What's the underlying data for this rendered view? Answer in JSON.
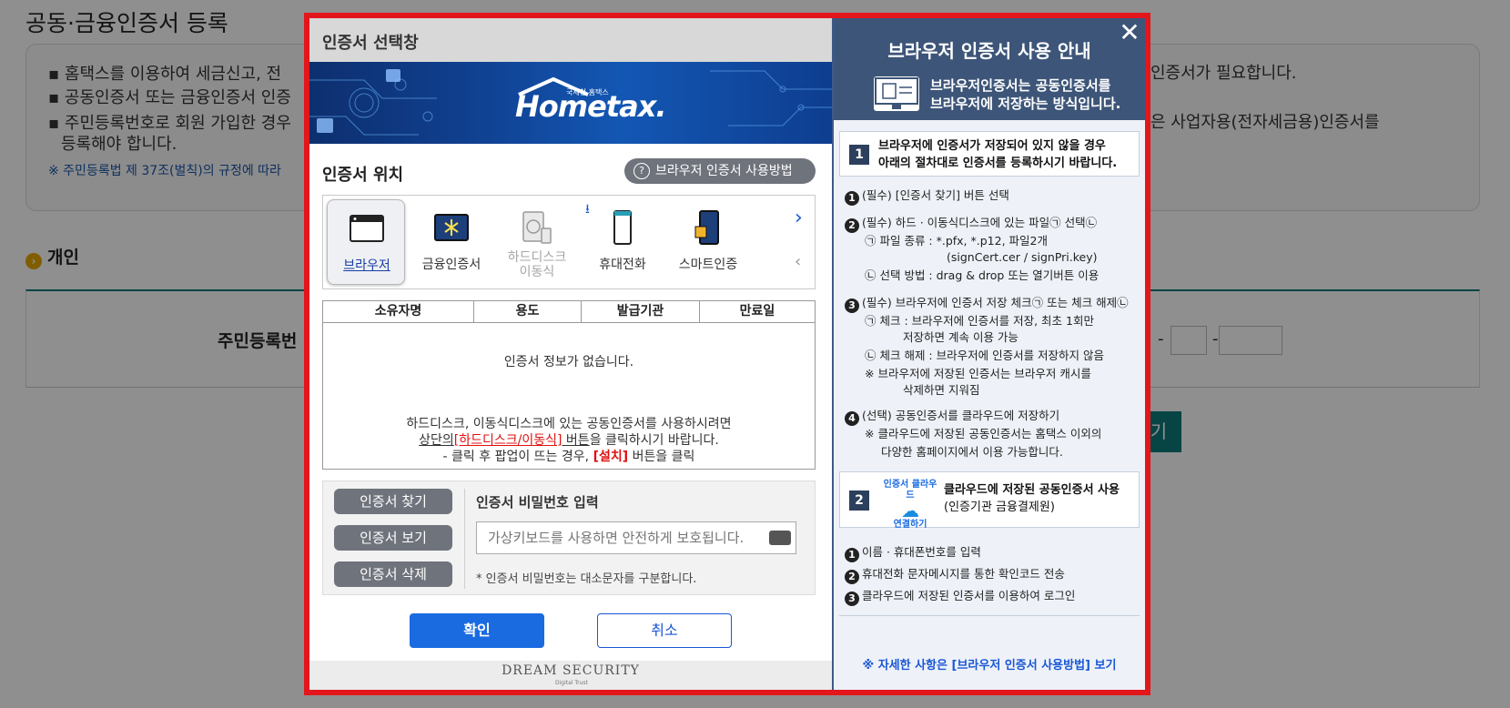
{
  "background": {
    "title": "공동·금융인증서 등록",
    "notice_lines": [
      "▪ 홈택스를 이용하여 세금신고, 전",
      "▪ 공동인증서 또는 금융인증서 인증",
      "▪ 주민등록번호로 회원 가입한 경우",
      "등록해야 합니다."
    ],
    "notice_law": "※ 주민등록법 제 37조(벌칙)의 규정에 따라",
    "notice_right_1": "인증서가 필요합니다.",
    "notice_right_2": "은 사업자용(전자세금용)인증서를",
    "section": "개인",
    "rrn_label": "주민등록번",
    "teal_btn": "기"
  },
  "modal": {
    "title": "인증서 선택창",
    "banner": {
      "brand": "Hometax.",
      "sub": "국세청 홈택스"
    },
    "location_title": "인증서 위치",
    "howto_button": "브라우저 인증서 사용방법",
    "locations": [
      {
        "label": "브라우저",
        "icon": "browser-icon",
        "active": true
      },
      {
        "label": "금융인증서",
        "icon": "financial-cert-icon",
        "active": false
      },
      {
        "label": "하드디스크\n이동식",
        "icon": "harddisk-icon",
        "active": false,
        "disabled": true
      },
      {
        "label": "휴대전화",
        "icon": "mobile-phone-icon",
        "active": false
      },
      {
        "label": "스마트인증",
        "icon": "smart-cert-icon",
        "active": false
      }
    ],
    "table": {
      "headers": [
        "소유자명",
        "용도",
        "발급기관",
        "만료일"
      ],
      "empty": "인증서 정보가 없습니다.",
      "msg_line1": "하드디스크, 이동식디스크에 있는 공동인증서를 사용하시려면",
      "msg_line2_a": "상단의",
      "msg_line2_b": "[하드디스크/이동식]",
      "msg_line2_c": " 버튼",
      "msg_line2_d": "을 클릭하시기 바랍니다.",
      "msg_line3_a": "- 클릭 후 팝업이 뜨는 경우, ",
      "msg_line3_b": "[설치]",
      "msg_line3_c": " 버튼을 클릭"
    },
    "buttons": {
      "find": "인증서 찾기",
      "view": "인증서 보기",
      "delete": "인증서 삭제"
    },
    "password": {
      "title": "인증서 비밀번호 입력",
      "placeholder": "가상키보드를 사용하면 안전하게 보호됩니다.",
      "note": "* 인증서 비밀번호는 대소문자를 구분합니다."
    },
    "ok": "확인",
    "cancel": "취소",
    "footer": {
      "brand": "DREAM SECURITY",
      "tagline": "Digital Trust"
    }
  },
  "guide": {
    "title": "브라우저 인증서 사용 안내",
    "desc1": "브라우저인증서는 공동인증서를",
    "desc2": "브라우저에 저장하는 방식입니다.",
    "close": "✕",
    "step1": {
      "num": "1",
      "line1": "브라우저에 인증서가 저장되어 있지 않을 경우",
      "line2": "아래의 절차대로 인증서를 등록하시기 바랍니다."
    },
    "s1_items": [
      "(필수) [인증서 찾기] 버튼 선택",
      "(필수) 하드 · 이동식디스크에 있는 파일㉠ 선택㉡",
      "㉠ 파일 종류 : *.pfx, *.p12, 파일2개",
      "(signCert.cer / signPri.key)",
      "㉡ 선택 방법 : drag & drop 또는 열기버튼 이용",
      "(필수) 브라우저에 인증서 저장 체크㉠ 또는 체크 해제㉡",
      "㉠ 체크 : 브라우저에 인증서를 저장, 최초 1회만",
      "저장하면 계속 이용 가능",
      "㉡ 체크 해제 : 브라우저에 인증서를 저장하지 않음",
      "※ 브라우저에 저장된 인증서는 브라우저 캐시를",
      "삭제하면 지워짐",
      "(선택) 공동인증서를 클라우드에 저장하기",
      "※ 클라우드에 저장된 공동인증서는 홈택스 이외의",
      "다양한 홈페이지에서 이용 가능합니다."
    ],
    "step2": {
      "num": "2",
      "cloud_top": "인증서 클라우드",
      "cloud_bottom": "연결하기",
      "line1": "클라우드에 저장된 공동인증서 사용",
      "line2": "(인증기관 금융결제원)"
    },
    "s2_items": [
      "이름 · 휴대폰번호를 입력",
      "휴대전화 문자메시지를 통한 확인코드 전송",
      "클라우드에 저장된 인증서를 이용하여 로그인"
    ],
    "link": "※ 자세한 사항은 [브라우저 인증서 사용방법] 보기"
  },
  "colors": {
    "modal_border": "#e3161c",
    "primary": "#1a6be0",
    "guide_header": "#3d5578",
    "gray_button": "#6f737c"
  }
}
